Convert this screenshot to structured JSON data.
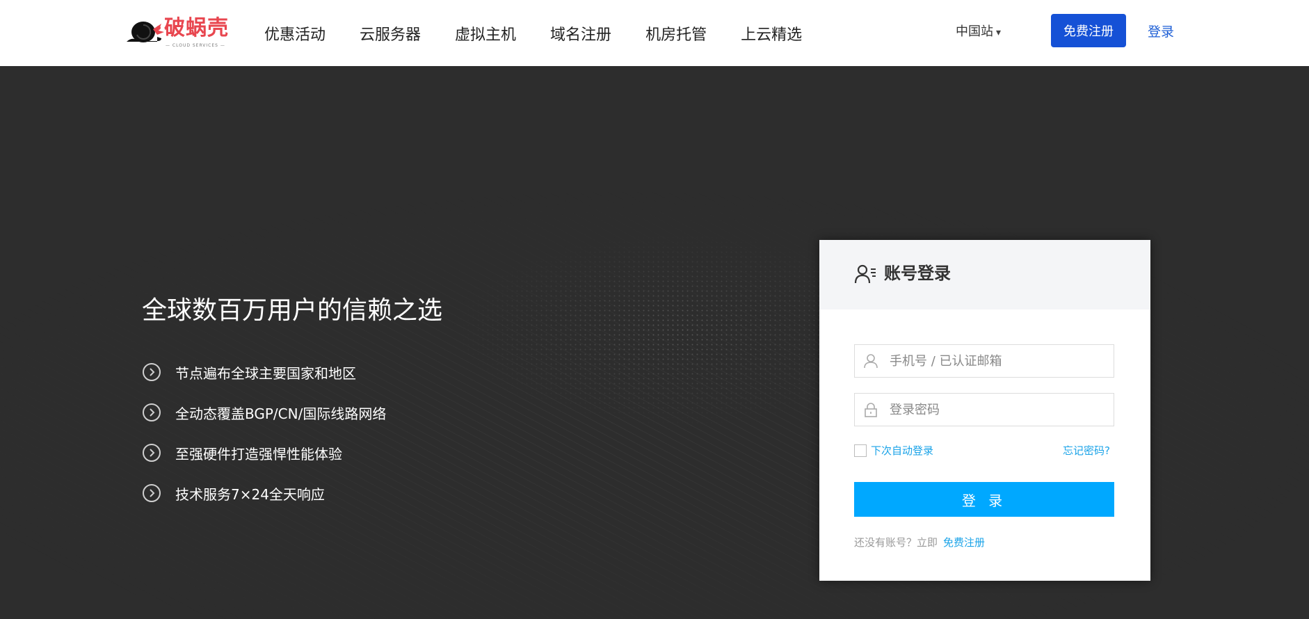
{
  "header": {
    "logo_text": "破蜗壳",
    "logo_sub": "— CLOUD SERVICES —",
    "nav": [
      "优惠活动",
      "云服务器",
      "虚拟主机",
      "域名注册",
      "机房托管",
      "上云精选"
    ],
    "region": "中国站",
    "region_caret": "▾",
    "register_label": "免费注册",
    "login_label": "登录"
  },
  "hero": {
    "title": "全球数百万用户的信赖之选",
    "features": [
      "节点遍布全球主要国家和地区",
      "全动态覆盖BGP/CN/国际线路网络",
      "至强硬件打造强悍性能体验",
      "技术服务7×24全天响应"
    ]
  },
  "login": {
    "title": "账号登录",
    "username_placeholder": "手机号 / 已认证邮箱",
    "password_placeholder": "登录密码",
    "remember_label": "下次自动登录",
    "forgot_label": "忘记密码?",
    "submit_label": "登 录",
    "signup_prompt": "还没有账号？立即",
    "signup_link": "免费注册"
  },
  "colors": {
    "brand_red": "#e8464f",
    "primary_blue": "#1551d6",
    "login_button": "#00a8ff",
    "link_blue": "#1aa3e8",
    "hero_bg": "#2d2d2d"
  }
}
